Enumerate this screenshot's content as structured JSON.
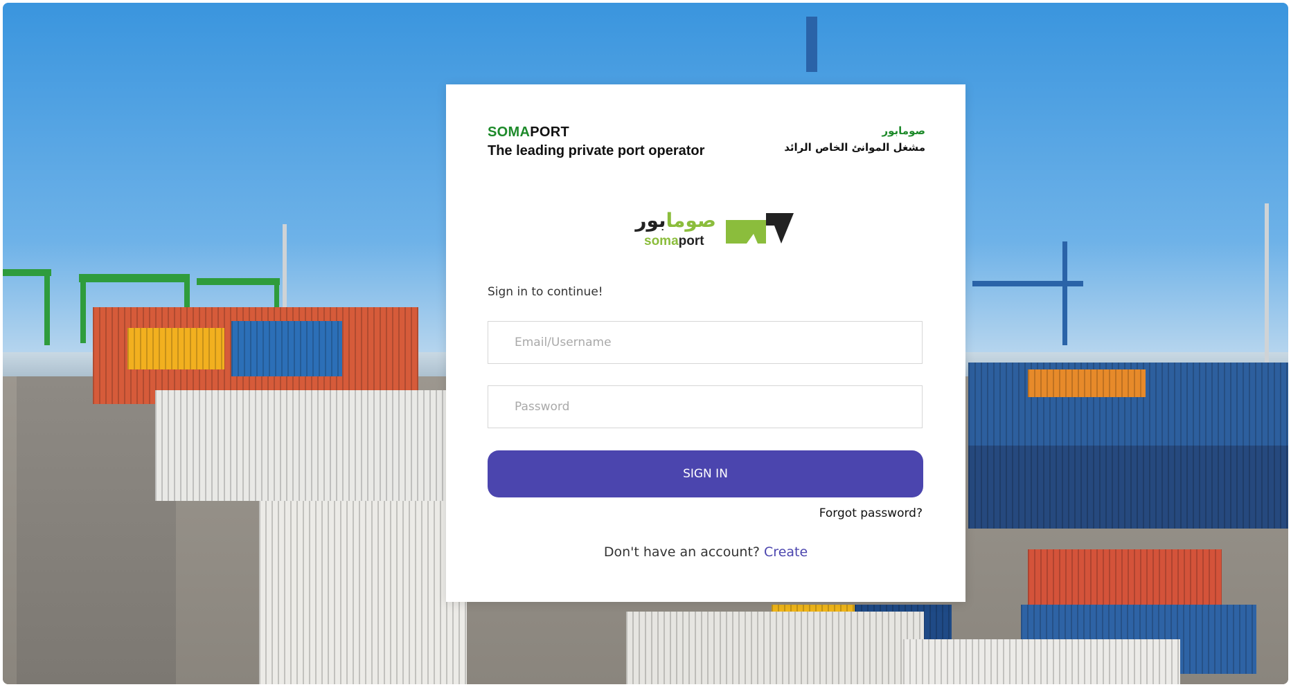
{
  "header": {
    "brand_green": "SOMA",
    "brand_dark": "PORT",
    "tagline": "The leading private port operator",
    "arabic_name": "صومابور",
    "arabic_tagline": "مشغل الموانئ الخاص الرائد"
  },
  "logo": {
    "arabic_green": "صوما",
    "arabic_dark": "بور",
    "en_green": "soma",
    "en_dark": "port",
    "icon": "somaport-logo-icon"
  },
  "form": {
    "subtitle": "Sign in to continue!",
    "email_placeholder": "Email/Username",
    "password_placeholder": "Password",
    "submit_label": "SIGN IN",
    "forgot_label": "Forgot password?",
    "signup_prompt": "Don't have an account?",
    "signup_link": "Create"
  },
  "colors": {
    "primary": "#4b45ae",
    "brand_green": "#1d8a2a",
    "logo_green": "#8bbd3c"
  }
}
